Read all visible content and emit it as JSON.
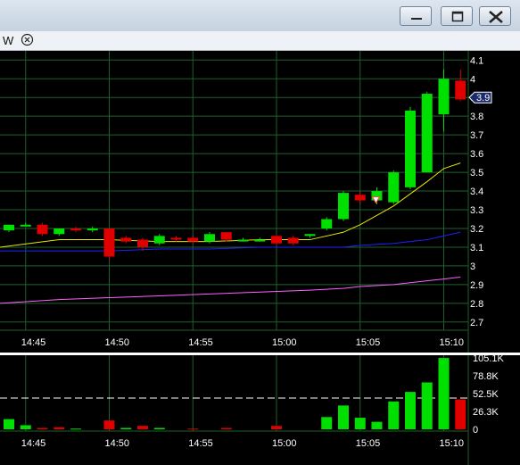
{
  "window": {
    "toolbar_label": "W",
    "buttons": [
      "minimize",
      "maximize",
      "close"
    ]
  },
  "price_axis": {
    "ticks": [
      "4.1",
      "4",
      "3.9",
      "3.8",
      "3.7",
      "3.6",
      "3.5",
      "3.4",
      "3.3",
      "3.2",
      "3.1",
      "3",
      "2.9",
      "2.8",
      "2.7"
    ],
    "current_price": "3.9"
  },
  "volume_axis": {
    "ticks": [
      "105.1K",
      "78.8K",
      "52.5K",
      "26.3K",
      "0"
    ]
  },
  "time_axis": {
    "ticks": [
      "14:45",
      "14:50",
      "14:55",
      "15:00",
      "15:05",
      "15:10"
    ]
  },
  "colors": {
    "background": "#000000",
    "grid": "#1f5f2c",
    "up": "#00e000",
    "down": "#e00000",
    "sma_short": "#e8e800",
    "sma_mid": "#2020ff",
    "sma_long": "#ff60ff"
  },
  "chart_data": [
    {
      "type": "candlestick",
      "x": [
        "14:44",
        "14:45",
        "14:46",
        "14:47",
        "14:48",
        "14:49",
        "14:50",
        "14:51",
        "14:52",
        "14:53",
        "14:54",
        "14:55",
        "14:56",
        "14:57",
        "14:58",
        "14:59",
        "15:00",
        "15:01",
        "15:02",
        "15:03",
        "15:04",
        "15:05",
        "15:06",
        "15:07",
        "15:08",
        "15:09",
        "15:10",
        "15:11"
      ],
      "open": [
        3.19,
        3.22,
        3.22,
        3.17,
        3.2,
        3.19,
        3.2,
        3.15,
        3.14,
        3.12,
        3.15,
        3.15,
        3.13,
        3.18,
        3.14,
        3.14,
        3.16,
        3.15,
        3.16,
        3.2,
        3.25,
        3.38,
        3.35,
        3.34,
        3.42,
        3.5,
        3.81,
        3.99
      ],
      "close": [
        3.22,
        3.22,
        3.17,
        3.2,
        3.19,
        3.2,
        3.05,
        3.13,
        3.1,
        3.16,
        3.14,
        3.13,
        3.17,
        3.14,
        3.14,
        3.14,
        3.12,
        3.12,
        3.17,
        3.25,
        3.39,
        3.35,
        3.4,
        3.5,
        3.83,
        3.92,
        4.0,
        3.89
      ],
      "high": [
        3.22,
        3.23,
        3.23,
        3.2,
        3.21,
        3.21,
        3.2,
        3.16,
        3.15,
        3.17,
        3.16,
        3.16,
        3.18,
        3.18,
        3.15,
        3.15,
        3.17,
        3.16,
        3.17,
        3.26,
        3.4,
        3.4,
        3.42,
        3.51,
        3.85,
        3.93,
        4.05,
        4.05
      ],
      "low": [
        3.18,
        3.21,
        3.16,
        3.16,
        3.18,
        3.18,
        3.03,
        3.12,
        3.08,
        3.11,
        3.13,
        3.12,
        3.12,
        3.13,
        3.13,
        3.13,
        3.11,
        3.11,
        3.15,
        3.19,
        3.24,
        3.33,
        3.33,
        3.33,
        3.41,
        3.66,
        3.72,
        3.88
      ],
      "ylim": [
        2.68,
        4.13
      ]
    },
    {
      "type": "line",
      "x": [
        "14:44",
        "14:47",
        "14:50",
        "14:53",
        "14:56",
        "14:59",
        "15:02",
        "15:04",
        "15:05",
        "15:07",
        "15:09",
        "15:10",
        "15:11"
      ],
      "series": [
        {
          "values": [
            3.1,
            3.14,
            3.14,
            3.13,
            3.13,
            3.14,
            3.14,
            3.18,
            3.22,
            3.32,
            3.45,
            3.52,
            3.55
          ]
        },
        {
          "values": [
            3.08,
            3.08,
            3.08,
            3.09,
            3.09,
            3.1,
            3.1,
            3.1,
            3.11,
            3.12,
            3.14,
            3.16,
            3.18
          ]
        },
        {
          "values": [
            2.8,
            2.82,
            2.83,
            2.84,
            2.85,
            2.86,
            2.87,
            2.88,
            2.89,
            2.9,
            2.92,
            2.93,
            2.94
          ]
        }
      ],
      "ylim": [
        2.68,
        4.13
      ]
    },
    {
      "type": "bar",
      "x": [
        "14:44",
        "14:45",
        "14:46",
        "14:47",
        "14:48",
        "14:49",
        "14:50",
        "14:51",
        "14:52",
        "14:53",
        "14:54",
        "14:55",
        "14:56",
        "14:57",
        "14:58",
        "14:59",
        "15:00",
        "15:01",
        "15:02",
        "15:03",
        "15:04",
        "15:05",
        "15:06",
        "15:07",
        "15:08",
        "15:09",
        "15:10",
        "15:11"
      ],
      "values": [
        15000,
        6000,
        2000,
        3000,
        1000,
        0,
        13000,
        2000,
        5000,
        2000,
        0,
        1000,
        0,
        2000,
        0,
        0,
        5000,
        0,
        0,
        18000,
        35000,
        17000,
        11000,
        41000,
        55000,
        69000,
        105000,
        44000
      ],
      "directions": [
        "up",
        "up",
        "down",
        "down",
        "up",
        "up",
        "down",
        "up",
        "down",
        "up",
        "down",
        "down",
        "up",
        "down",
        "up",
        "up",
        "down",
        "down",
        "up",
        "up",
        "up",
        "up",
        "up",
        "up",
        "up",
        "up",
        "up",
        "down"
      ],
      "reference_line": 46000,
      "ylim": [
        0,
        105100
      ]
    }
  ]
}
